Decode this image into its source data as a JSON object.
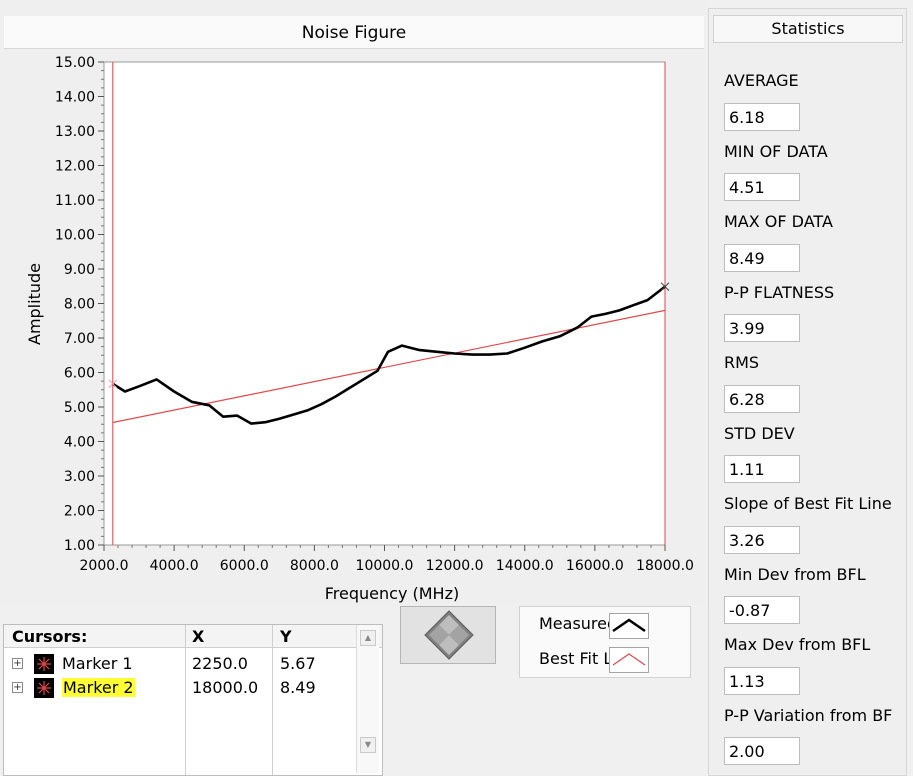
{
  "graph": {
    "title": "Noise Figure",
    "chart_data": {
      "type": "line",
      "xlabel": "Frequency (MHz)",
      "ylabel": "Amplitude",
      "xlim": [
        2000,
        18000
      ],
      "ylim": [
        1,
        15
      ],
      "x_ticks": [
        "2000.0",
        "4000.0",
        "6000.0",
        "8000.0",
        "10000.0",
        "12000.0",
        "14000.0",
        "16000.0",
        "18000.0"
      ],
      "y_ticks": [
        "1.00",
        "2.00",
        "3.00",
        "4.00",
        "5.00",
        "6.00",
        "7.00",
        "8.00",
        "9.00",
        "10.00",
        "11.00",
        "12.00",
        "13.00",
        "14.00",
        "15.00"
      ],
      "series": [
        {
          "name": "Measured",
          "color": "#000000",
          "x": [
            2250,
            2600,
            3000,
            3500,
            4000,
            4500,
            5000,
            5400,
            5800,
            6200,
            6600,
            7000,
            7400,
            7800,
            8200,
            8600,
            9000,
            9400,
            9800,
            10100,
            10500,
            11000,
            11500,
            12000,
            12500,
            13000,
            13500,
            14000,
            14500,
            15000,
            15500,
            15900,
            16300,
            16700,
            17100,
            17500,
            18000
          ],
          "y": [
            5.67,
            5.45,
            5.6,
            5.8,
            5.45,
            5.15,
            5.05,
            4.72,
            4.75,
            4.52,
            4.56,
            4.66,
            4.78,
            4.9,
            5.08,
            5.3,
            5.55,
            5.8,
            6.05,
            6.6,
            6.78,
            6.65,
            6.6,
            6.55,
            6.52,
            6.52,
            6.55,
            6.72,
            6.9,
            7.05,
            7.3,
            7.62,
            7.7,
            7.8,
            7.95,
            8.1,
            8.49
          ]
        },
        {
          "name": "Best Fit Line",
          "color": "#e0474c",
          "x": [
            2250,
            18000
          ],
          "y": [
            4.55,
            7.8
          ]
        }
      ],
      "cursors_x": [
        2250,
        18000
      ]
    }
  },
  "legend": {
    "items": [
      {
        "label": "Measured"
      },
      {
        "label": "Best Fit Line"
      }
    ]
  },
  "cursor_table": {
    "headers": {
      "name": "Cursors:",
      "x": "X",
      "y": "Y"
    },
    "rows": [
      {
        "name": "Marker 1",
        "x": "2250.0",
        "y": "5.67"
      },
      {
        "name": "Marker 2",
        "x": "18000.0",
        "y": "8.49"
      }
    ]
  },
  "statistics": {
    "title": "Statistics",
    "items": [
      {
        "label": "AVERAGE",
        "value": "6.18"
      },
      {
        "label": "MIN OF DATA",
        "value": "4.51"
      },
      {
        "label": "MAX OF DATA",
        "value": "8.49"
      },
      {
        "label": "P-P FLATNESS",
        "value": "3.99"
      },
      {
        "label": "RMS",
        "value": "6.28"
      },
      {
        "label": "STD DEV",
        "value": "1.11"
      },
      {
        "label": "Slope of Best Fit Line",
        "value": "3.26"
      },
      {
        "label": "Min Dev from BFL",
        "value": "-0.87"
      },
      {
        "label": "Max Dev from BFL",
        "value": "1.13"
      },
      {
        "label": "P-P Variation from BF",
        "value": "2.00"
      }
    ]
  }
}
